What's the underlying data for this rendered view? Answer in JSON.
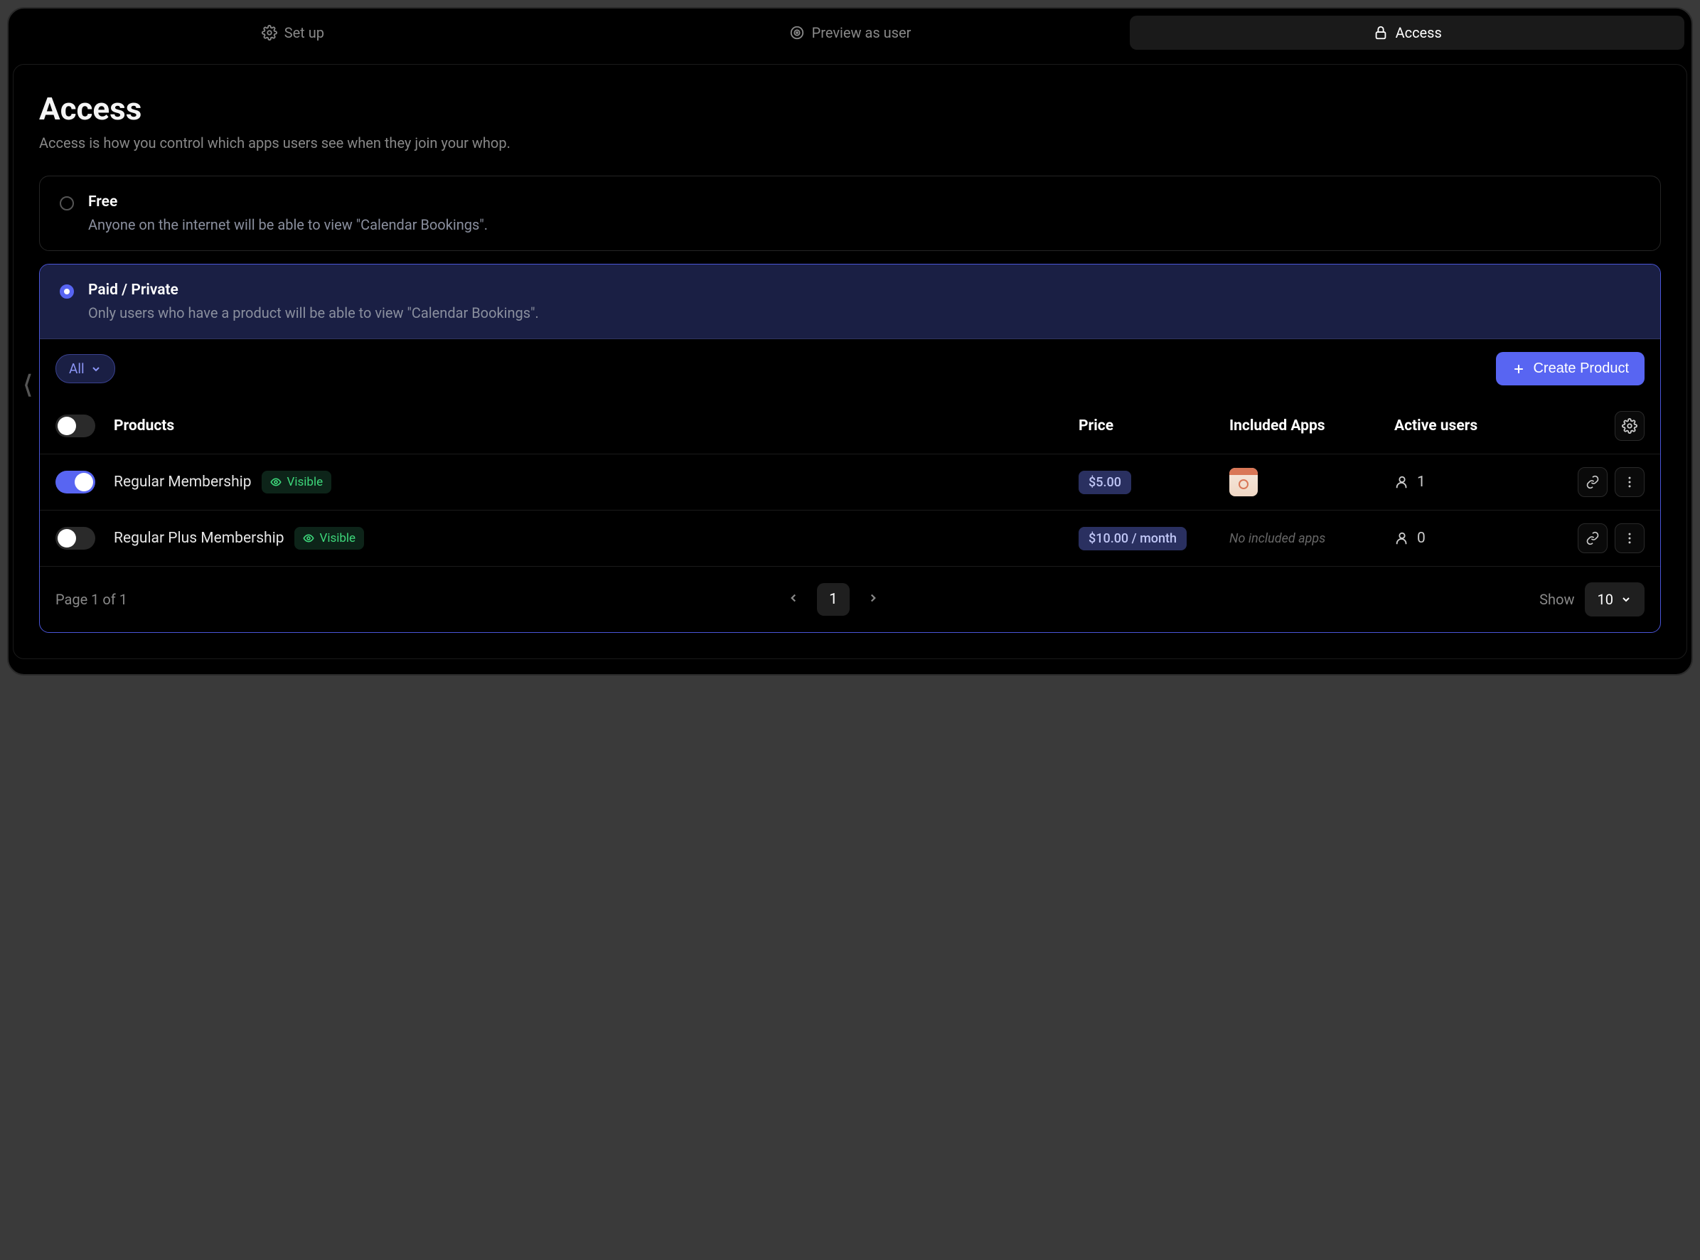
{
  "tabs": {
    "setup": "Set up",
    "preview": "Preview as user",
    "access": "Access"
  },
  "page": {
    "title": "Access",
    "description": "Access is how you control which apps users see when they join your whop."
  },
  "options": {
    "free": {
      "title": "Free",
      "description": "Anyone on the internet will be able to view \"Calendar Bookings\"."
    },
    "paid": {
      "title": "Paid / Private",
      "description": "Only users who have a product will be able to view \"Calendar Bookings\"."
    }
  },
  "toolbar": {
    "filter": "All",
    "create": "Create Product"
  },
  "table": {
    "headers": {
      "products": "Products",
      "price": "Price",
      "apps": "Included Apps",
      "users": "Active users"
    },
    "rows": [
      {
        "enabled": true,
        "name": "Regular Membership",
        "visibility": "Visible",
        "price": "$5.00",
        "apps_type": "icon",
        "users": "1"
      },
      {
        "enabled": false,
        "name": "Regular Plus Membership",
        "visibility": "Visible",
        "price": "$10.00 / month",
        "apps_type": "none",
        "apps_text": "No included apps",
        "users": "0"
      }
    ]
  },
  "pagination": {
    "info": "Page 1 of 1",
    "current": "1",
    "show_label": "Show",
    "show_value": "10"
  }
}
